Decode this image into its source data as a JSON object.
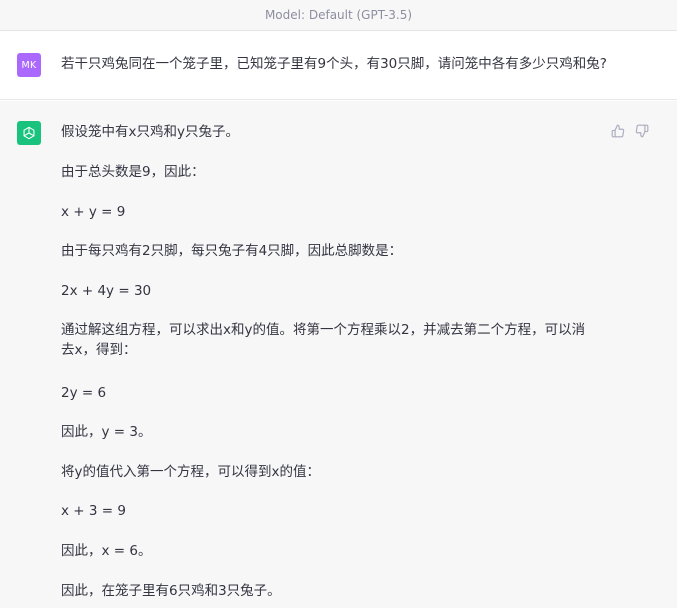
{
  "header": {
    "model_label": "Model: Default (GPT-3.5)"
  },
  "user_message": {
    "avatar_initials": "MK",
    "avatar_color": "#ab68ff",
    "text": "若干只鸡兔同在一个笼子里，已知笼子里有9个头，有30只脚，请问笼中各有多少只鸡和兔?"
  },
  "assistant_message": {
    "avatar_icon": "openai-logo-icon",
    "avatar_color": "#19c37d",
    "feedback_icons": [
      "thumbs-up-icon",
      "thumbs-down-icon"
    ],
    "paragraphs": [
      "假设笼中有x只鸡和y只兔子。",
      "由于总头数是9，因此：",
      "x + y = 9",
      "由于每只鸡有2只脚，每只兔子有4只脚，因此总脚数是：",
      "2x + 4y = 30",
      "通过解这组方程，可以求出x和y的值。将第一个方程乘以2，并减去第二个方程，可以消去x，得到：",
      "2y = 6",
      "因此，y = 3。",
      "将y的值代入第一个方程，可以得到x的值：",
      "x + 3 = 9",
      "因此，x = 6。",
      "因此，在笼子里有6只鸡和3只兔子。"
    ]
  }
}
